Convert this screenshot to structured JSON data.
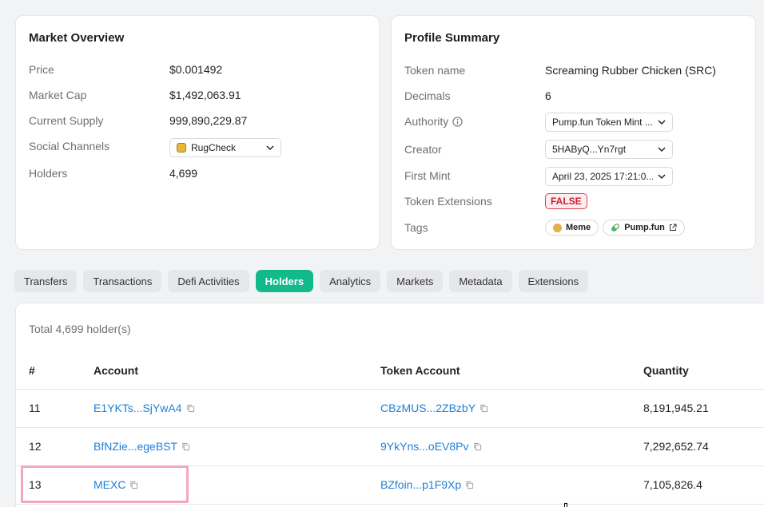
{
  "market_overview": {
    "title": "Market Overview",
    "rows": [
      {
        "label": "Price",
        "value": "$0.001492"
      },
      {
        "label": "Market Cap",
        "value": "$1,492,063.91"
      },
      {
        "label": "Current Supply",
        "value": "999,890,229.87"
      },
      {
        "label": "Social Channels",
        "value": "RugCheck"
      },
      {
        "label": "Holders",
        "value": "4,699"
      }
    ]
  },
  "profile_summary": {
    "title": "Profile Summary",
    "token_name": {
      "label": "Token name",
      "value": "Screaming Rubber Chicken (SRC)"
    },
    "decimals": {
      "label": "Decimals",
      "value": "6"
    },
    "authority": {
      "label": "Authority",
      "value": "Pump.fun Token Mint ..."
    },
    "creator": {
      "label": "Creator",
      "value": "5HAByQ...Yn7rgt"
    },
    "first_mint": {
      "label": "First Mint",
      "value": "April 23, 2025 17:21:0..."
    },
    "token_extensions": {
      "label": "Token Extensions",
      "value": "FALSE"
    },
    "tags": {
      "label": "Tags",
      "items": [
        "Meme",
        "Pump.fun"
      ]
    }
  },
  "tabs": [
    {
      "label": "Transfers",
      "active": false
    },
    {
      "label": "Transactions",
      "active": false
    },
    {
      "label": "Defi Activities",
      "active": false
    },
    {
      "label": "Holders",
      "active": true
    },
    {
      "label": "Analytics",
      "active": false
    },
    {
      "label": "Markets",
      "active": false
    },
    {
      "label": "Metadata",
      "active": false
    },
    {
      "label": "Extensions",
      "active": false
    }
  ],
  "holders": {
    "total_text": "Total 4,699 holder(s)",
    "columns": [
      "#",
      "Account",
      "Token Account",
      "Quantity"
    ],
    "rows": [
      {
        "rank": "11",
        "account": "E1YKTs...SjYwA4",
        "token_account": "CBzMUS...2ZBzbY",
        "quantity": "8,191,945.21"
      },
      {
        "rank": "12",
        "account": "BfNZie...egeBST",
        "token_account": "9YkYns...oEV8Pv",
        "quantity": "7,292,652.74"
      },
      {
        "rank": "13",
        "account": "MEXC",
        "token_account": "BZfoin...p1F9Xp",
        "quantity": "7,105,826.4"
      }
    ]
  },
  "colors": {
    "accent": "#12b98b",
    "link": "#1e7fd6",
    "false_badge": "#c8202f",
    "highlight": "#f2a7c3"
  }
}
